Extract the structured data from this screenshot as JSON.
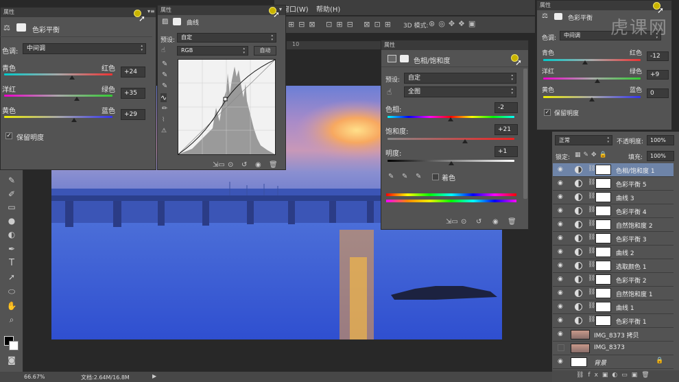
{
  "menubar": {
    "window": "窗口(W)",
    "help": "帮助(H)",
    "mode_3d": "3D 模式:"
  },
  "color_balance_top": {
    "tab": "属性",
    "title": "色彩平衡",
    "tone_label": "色调:",
    "tone_value": "中间调",
    "rows": [
      {
        "left": "青色",
        "right": "红色",
        "value": "+24"
      },
      {
        "left": "洋红",
        "right": "绿色",
        "value": "+35"
      },
      {
        "left": "黄色",
        "right": "蓝色",
        "value": "+29"
      }
    ],
    "preserve": "保留明度"
  },
  "curves": {
    "tab": "属性",
    "title": "曲线",
    "preset_label": "预设:",
    "preset_value": "自定",
    "channel": "RGB",
    "auto": "自动"
  },
  "hue_sat": {
    "tab": "属性",
    "title": "色相/饱和度",
    "preset_label": "预设:",
    "preset_value": "自定",
    "range": "全图",
    "hue_label": "色相:",
    "hue_value": "-2",
    "sat_label": "饱和度:",
    "sat_value": "+21",
    "light_label": "明度:",
    "light_value": "+1",
    "colorize": "着色"
  },
  "color_balance_right": {
    "tab": "属性",
    "title": "色彩平衡",
    "tone_label": "色调:",
    "tone_value": "中间调",
    "rows": [
      {
        "left": "青色",
        "right": "红色",
        "value": "-12"
      },
      {
        "left": "洋红",
        "right": "绿色",
        "value": "+9"
      },
      {
        "left": "黄色",
        "right": "蓝色",
        "value": "0"
      }
    ],
    "preserve": "保留明度"
  },
  "layers": {
    "blend_mode": "正常",
    "opacity_label": "不透明度:",
    "opacity_value": "100%",
    "lock_label": "锁定:",
    "fill_label": "填充:",
    "fill_value": "100%",
    "items": [
      {
        "name": "色相/饱和度 1"
      },
      {
        "name": "色彩平衡 5"
      },
      {
        "name": "曲线 3"
      },
      {
        "name": "色彩平衡 4"
      },
      {
        "name": "自然饱和度 2"
      },
      {
        "name": "色彩平衡 3"
      },
      {
        "name": "曲线 2"
      },
      {
        "name": "选取颜色 1"
      },
      {
        "name": "色彩平衡 2"
      },
      {
        "name": "自然饱和度 1"
      },
      {
        "name": "曲线 1"
      },
      {
        "name": "色彩平衡 1"
      },
      {
        "name": "IMG_8373 拷贝"
      },
      {
        "name": "IMG_8373"
      },
      {
        "name": "背景"
      }
    ]
  },
  "statusbar": {
    "zoom": "66.67%",
    "doc": "文档:2.64M/16.8M"
  },
  "watermark": "虎课网"
}
